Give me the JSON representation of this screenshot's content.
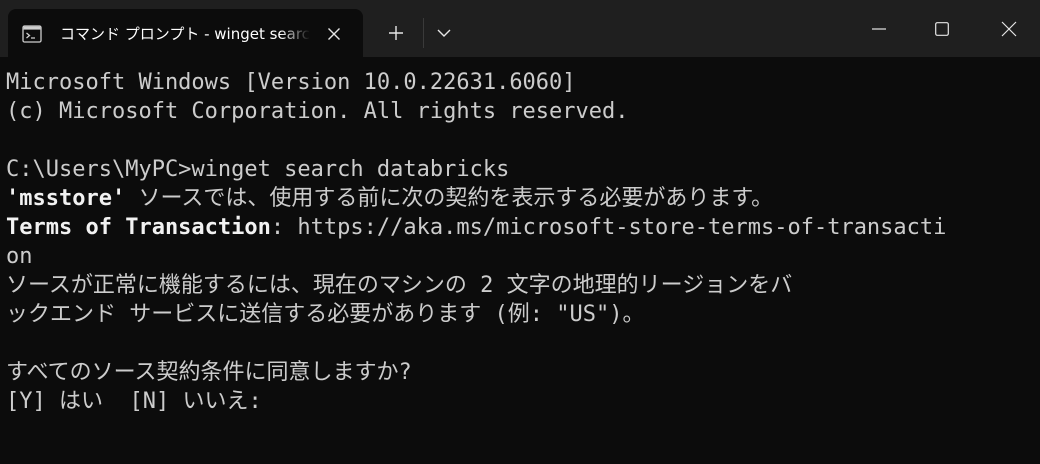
{
  "tab": {
    "title": "コマンド プロンプト - winget  search databricks",
    "icon": "cmd-icon"
  },
  "titlebar": {
    "new_tab_icon": "plus-icon",
    "dropdown_icon": "chevron-down-icon",
    "minimize_icon": "minimize-icon",
    "maximize_icon": "maximize-icon",
    "close_icon": "close-icon"
  },
  "terminal": {
    "lines": [
      "Microsoft Windows [Version 10.0.22631.6060]",
      "(c) Microsoft Corporation. All rights reserved.",
      "",
      "C:\\Users\\MyPC>winget search databricks",
      "",
      "",
      "on",
      "ソースが正常に機能するには、現在のマシンの 2 文字の地理的リージョンをバ",
      "ックエンド サービスに送信する必要があります (例: \"US\")。",
      "",
      "すべてのソース契約条件に同意しますか?",
      "[Y] はい  [N] いいえ:"
    ],
    "msstore_label": "'msstore'",
    "msstore_message": " ソースでは、使用する前に次の契約を表示する必要があります。",
    "terms_label": "Terms of Transaction",
    "terms_url": ": https://aka.ms/microsoft-store-terms-of-transacti"
  },
  "colors": {
    "background": "#0c0c0c",
    "titlebar": "#1f1f1f",
    "text": "#cccccc",
    "bright_text": "#f2f2f2"
  }
}
